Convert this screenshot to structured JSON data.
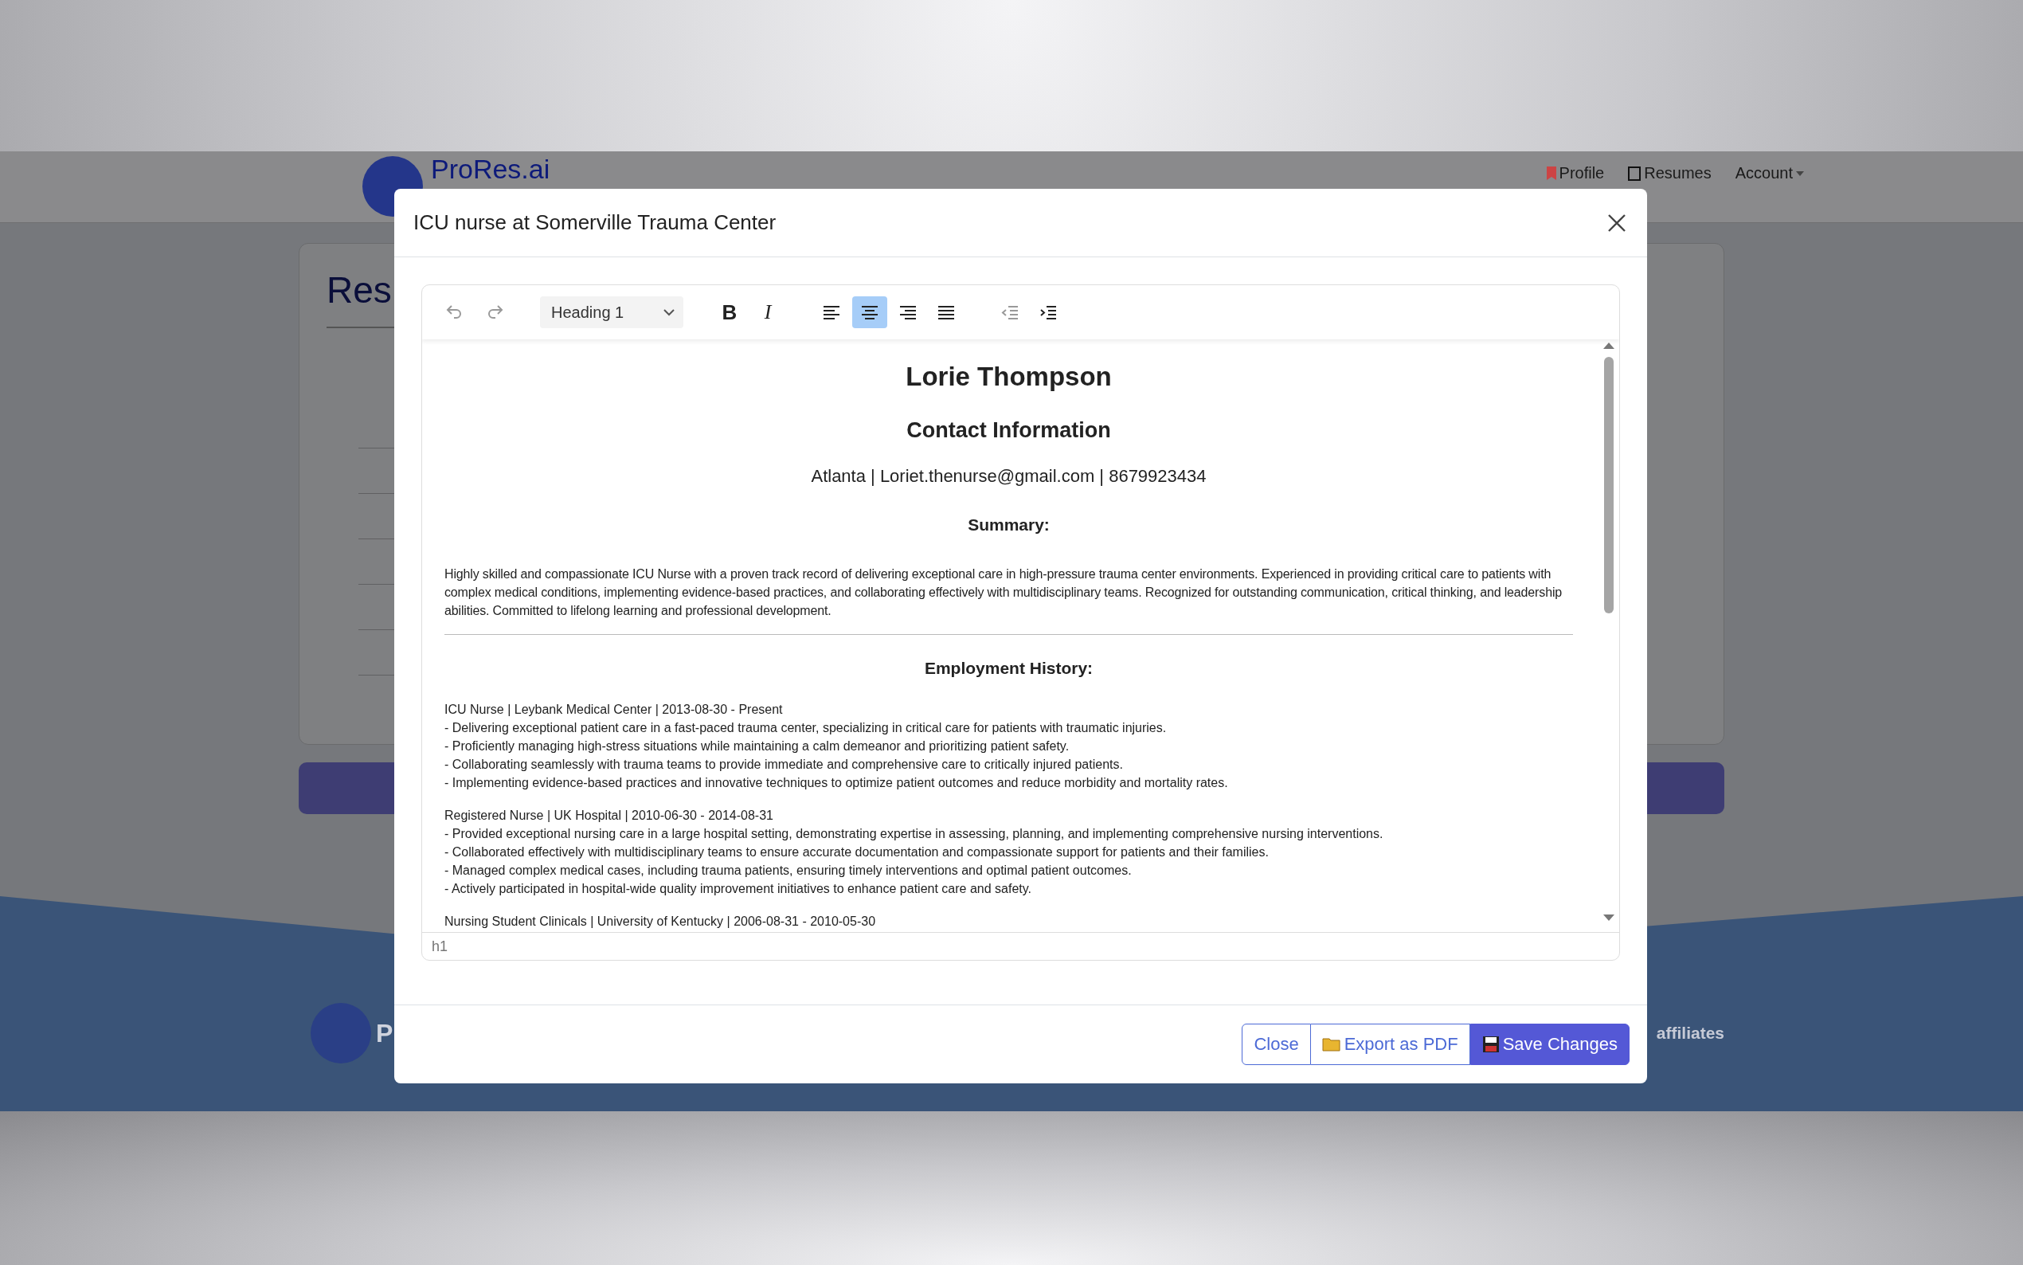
{
  "background_page": {
    "brand": "ProRes.ai",
    "nav_links": [
      "Profile",
      "Resumes",
      "Account"
    ],
    "page_heading": "Res",
    "footer_brand": "P",
    "footer_link": "affiliates"
  },
  "modal": {
    "title": "ICU nurse at Somerville Trauma Center",
    "toolbar": {
      "history": [
        {
          "kind": "undo",
          "disabled": true
        },
        {
          "kind": "redo",
          "disabled": true
        }
      ],
      "block_format": {
        "value": "Heading 1"
      },
      "formatting": [
        {
          "kind": "bold",
          "label": "B",
          "selected": false
        },
        {
          "kind": "italic",
          "label": "I",
          "selected": false
        }
      ],
      "alignment": [
        {
          "kind": "left",
          "selected": false
        },
        {
          "kind": "center",
          "selected": true
        },
        {
          "kind": "right",
          "selected": false
        },
        {
          "kind": "justify",
          "selected": false
        }
      ],
      "indentation": [
        {
          "kind": "outdent",
          "disabled": true
        },
        {
          "kind": "indent",
          "disabled": false
        }
      ]
    },
    "document": {
      "name": "Lorie Thompson",
      "contact_heading": "Contact Information",
      "contact_line": "Atlanta | Loriet.thenurse@gmail.com | 8679923434",
      "summary_heading": "Summary:",
      "summary": "Highly skilled and compassionate ICU Nurse with a proven track record of delivering exceptional care in high-pressure trauma center environments. Experienced in providing critical care to patients with complex medical conditions, implementing evidence-based practices, and collaborating effectively with multidisciplinary teams. Recognized for outstanding communication, critical thinking, and leadership abilities. Committed to lifelong learning and professional development.",
      "employment_heading": "Employment History:",
      "jobs": [
        {
          "title": "ICU Nurse | Leybank Medical Center | 2013-08-30 - Present",
          "bullets": [
            "- Delivering exceptional patient care in a fast-paced trauma center, specializing in critical care for patients with traumatic injuries.",
            "- Proficiently managing high-stress situations while maintaining a calm demeanor and prioritizing patient safety.",
            "- Collaborating seamlessly with trauma teams to provide immediate and comprehensive care to critically injured patients.",
            "- Implementing evidence-based practices and innovative techniques to optimize patient outcomes and reduce morbidity and mortality rates."
          ]
        },
        {
          "title": "Registered Nurse | UK Hospital | 2010-06-30 - 2014-08-31",
          "bullets": [
            "- Provided exceptional nursing care in a large hospital setting, demonstrating expertise in assessing, planning, and implementing comprehensive nursing interventions.",
            "- Collaborated effectively with multidisciplinary teams to ensure accurate documentation and compassionate support for patients and their families.",
            "- Managed complex medical cases, including trauma patients, ensuring timely interventions and optimal patient outcomes.",
            "- Actively participated in hospital-wide quality improvement initiatives to enhance patient care and safety."
          ]
        },
        {
          "title": "Nursing Student Clinicals | University of Kentucky | 2006-08-31 - 2010-05-30"
        }
      ]
    },
    "status_bar": "h1",
    "buttons": [
      {
        "kind": "close",
        "label": "Close"
      },
      {
        "kind": "export",
        "label": "Export as PDF"
      },
      {
        "kind": "save",
        "label": "Save Changes"
      }
    ]
  }
}
